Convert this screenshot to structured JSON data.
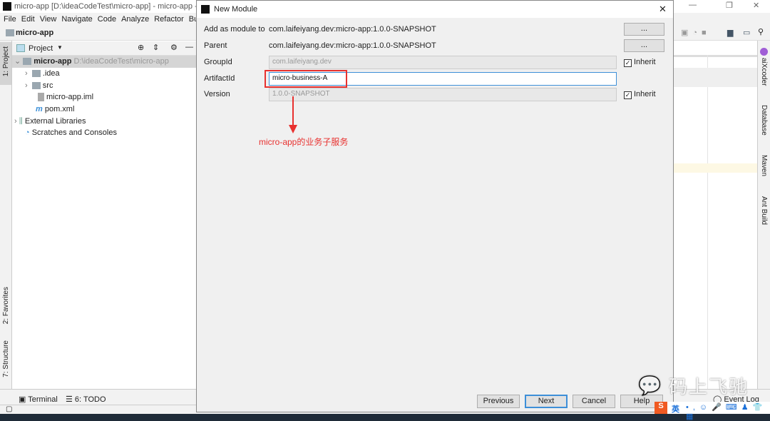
{
  "window": {
    "title": "micro-app [D:\\ideaCodeTest\\micro-app] - micro-app -"
  },
  "menu": [
    "File",
    "Edit",
    "View",
    "Navigate",
    "Code",
    "Analyze",
    "Refactor",
    "Bu"
  ],
  "navbar": {
    "project": "micro-app"
  },
  "left_strip": {
    "project": "1: Project",
    "favorites": "2: Favorites",
    "structure": "7: Structure"
  },
  "project_panel": {
    "title": "Project",
    "root": {
      "name": "micro-app",
      "path": "D:\\ideaCodeTest\\micro-app"
    },
    "items": [
      ".idea",
      "src",
      "micro-app.iml",
      "pom.xml",
      "External Libraries",
      "Scratches and Consoles"
    ]
  },
  "right_strip": [
    "aiXcoder",
    "Database",
    "Maven",
    "Ant Build"
  ],
  "bottom_tabs": {
    "terminal": "Terminal",
    "todo": "6: TODO"
  },
  "status": {
    "event_log": "Event Log"
  },
  "dialog": {
    "title": "New Module",
    "add_as_module_label": "Add as module to",
    "add_as_module_value": "com.laifeiyang.dev:micro-app:1.0.0-SNAPSHOT",
    "parent_label": "Parent",
    "parent_value": "com.laifeiyang.dev:micro-app:1.0.0-SNAPSHOT",
    "groupid_label": "GroupId",
    "groupid_value": "com.laifeiyang.dev",
    "artifactid_label": "ArtifactId",
    "artifactid_value": "micro-business-A",
    "version_label": "Version",
    "version_value": "1.0.0-SNAPSHOT",
    "browse": "...",
    "inherit": "Inherit",
    "buttons": {
      "previous": "Previous",
      "next": "Next",
      "cancel": "Cancel",
      "help": "Help"
    }
  },
  "annotation": {
    "text": "micro-app的业务子服务",
    "color": "#e8312f"
  },
  "watermark": "码上飞驰",
  "ime": {
    "lang": "英"
  }
}
